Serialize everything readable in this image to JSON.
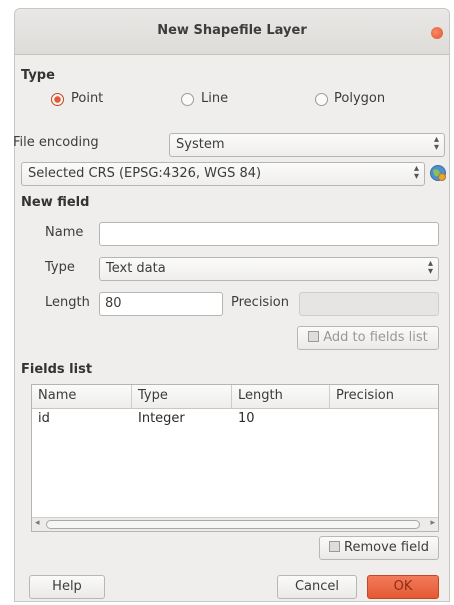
{
  "window": {
    "title": "New Shapefile Layer"
  },
  "type_section": {
    "label": "Type",
    "options": [
      {
        "label": "Point",
        "checked": true
      },
      {
        "label": "Line",
        "checked": false
      },
      {
        "label": "Polygon",
        "checked": false
      }
    ]
  },
  "encoding": {
    "label": "File encoding",
    "value": "System"
  },
  "crs": {
    "value": "Selected CRS (EPSG:4326, WGS 84)"
  },
  "new_field": {
    "label": "New field",
    "name_label": "Name",
    "name_value": "",
    "type_label": "Type",
    "type_value": "Text data",
    "length_label": "Length",
    "length_value": "80",
    "precision_label": "Precision",
    "precision_value": "",
    "add_button": "Add to fields list"
  },
  "fields_list": {
    "label": "Fields list",
    "columns": [
      "Name",
      "Type",
      "Length",
      "Precision"
    ],
    "rows": [
      {
        "name": "id",
        "type": "Integer",
        "length": "10",
        "precision": ""
      }
    ],
    "remove_button": "Remove field"
  },
  "footer": {
    "help": "Help",
    "cancel": "Cancel",
    "ok": "OK"
  },
  "colors": {
    "accent": "#e35a34",
    "window_bg": "#efeeec"
  }
}
